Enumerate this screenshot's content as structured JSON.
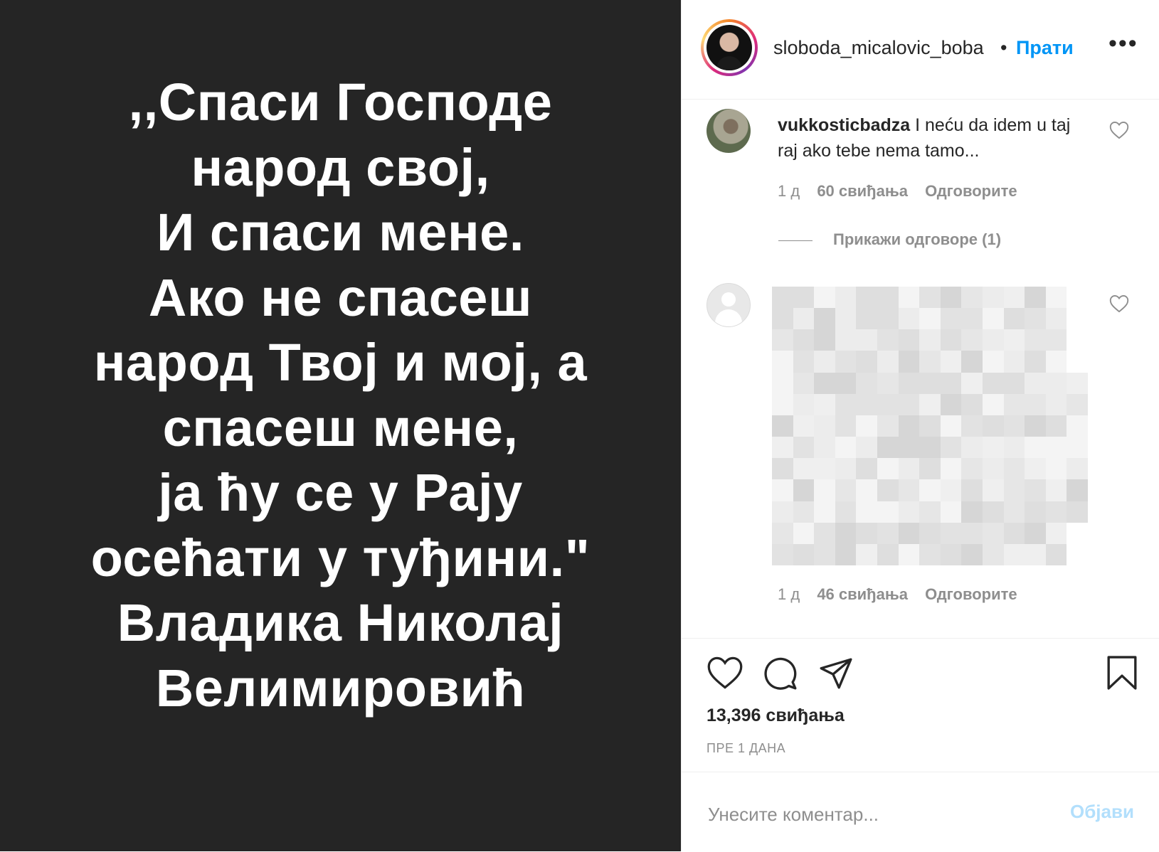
{
  "post_image": {
    "quote_lines": [
      ",,Спаси Господе",
      "народ свој,",
      "И спаси мене.",
      "Ако не спасеш",
      "народ Твој и мој, а",
      "спасеш мене,",
      "ја ћу се у Рају",
      "осећати у туђини.\"",
      "Владика Николај",
      "Велимировић"
    ]
  },
  "header": {
    "username": "sloboda_micalovic_boba",
    "separator": "•",
    "follow_label": "Прати",
    "more_label": "•••"
  },
  "comments": [
    {
      "username": "vukkosticbadza",
      "text": "I neću da idem u taj raj ako tebe nema tamo...",
      "time": "1 д",
      "likes": "60 свиђања",
      "reply_label": "Одговорите",
      "view_replies": "Прикажи одговоре (1)"
    },
    {
      "time": "1 д",
      "likes": "46 свиђања",
      "reply_label": "Одговорите"
    }
  ],
  "actions": {
    "likes_count": "13,396 свиђања",
    "timestamp": "ПРЕ 1 ДАНА"
  },
  "composer": {
    "placeholder": "Унесите коментар...",
    "post_label": "Објави"
  },
  "icons": {
    "like": "heart-icon",
    "comment": "comment-bubble-icon",
    "share": "paper-plane-icon",
    "save": "bookmark-icon",
    "comment_like": "heart-outline-icon"
  },
  "colors": {
    "image_background": "#252525",
    "link_blue": "#0095f6",
    "post_button_disabled": "#b2dffc",
    "secondary_text": "#8e8e8e"
  }
}
